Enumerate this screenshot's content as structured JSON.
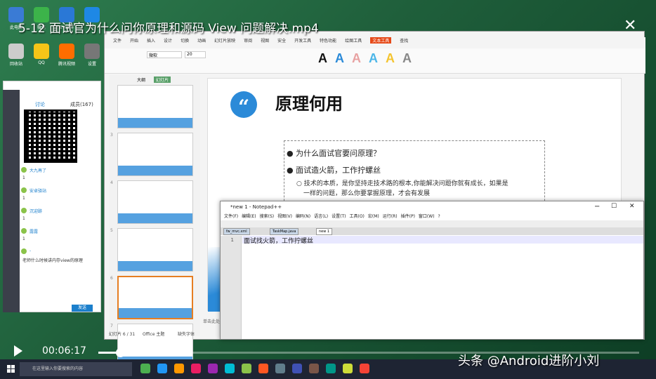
{
  "video": {
    "title": "5-12 面试官为什么问你原理和源码 View 问题解决.mp4",
    "elapsed": "00:06:17",
    "progress_fraction": 0.04
  },
  "watermark": "头条 @Android进阶小刘",
  "desktop_icons": [
    {
      "label": "此电脑",
      "color": "#3a7bd5"
    },
    {
      "label": "微信",
      "color": "#3cb34a"
    },
    {
      "label": "EV录屏",
      "color": "#2a78d6"
    },
    {
      "label": "IE",
      "color": "#1e88e5"
    },
    {
      "label": "回收站",
      "color": "#cccccc"
    },
    {
      "label": "QQ",
      "color": "#f5c518"
    },
    {
      "label": "腾讯视频",
      "color": "#ff6d00"
    },
    {
      "label": "设置",
      "color": "#777777"
    }
  ],
  "chat": {
    "tab_chat": "讨论",
    "tab_members": "成员(167)",
    "items": [
      {
        "name": "大九再了",
        "msg": "1"
      },
      {
        "name": "安卓驿站",
        "msg": "1"
      },
      {
        "name": "沉迎跡",
        "msg": "1"
      },
      {
        "name": "露露",
        "msg": "1"
      },
      {
        "name": "-",
        "msg": "老师什么时候讲内存view的原理"
      }
    ],
    "send_label": "发送"
  },
  "wps": {
    "menu": [
      "文件",
      "开始",
      "插入",
      "设计",
      "切换",
      "动画",
      "幻灯片放映",
      "审阅",
      "视图",
      "安全",
      "开发工具",
      "特色功能",
      "绘图工具",
      "文本工具",
      "查找"
    ],
    "font_name": "微软",
    "font_size": "20",
    "panel_tabs": [
      "大纲",
      "幻灯片"
    ],
    "slide_count_label": "幻灯片 6 / 31",
    "theme_label": "Office 主题",
    "missing_font": "缺失字体",
    "notes": "单击此处添加备注",
    "slide": {
      "title": "原理何用",
      "bullet1": "为什么面试官要问原理？",
      "bullet2": "面试造火箭，工作拧螺丝",
      "sub1": "技术的本质，是你坚持走技术路的根本,你能解决问题你就有成长，如果是",
      "sub2": "一样的问题，那么你要掌握原理，才会有发展"
    },
    "thumb_numbers": [
      "",
      "3",
      "4",
      "5",
      "6",
      "7"
    ]
  },
  "notepad": {
    "title": "*new 1 - Notepad++",
    "menu": [
      "文件(F)",
      "编辑(E)",
      "搜索(S)",
      "视图(V)",
      "编码(N)",
      "语言(L)",
      "设置(T)",
      "工具(O)",
      "宏(M)",
      "运行(R)",
      "插件(P)",
      "窗口(W)",
      "?"
    ],
    "tabs": [
      "fw_mvc.xml",
      "TaskMap.java",
      "new 1"
    ],
    "line_no": "1",
    "line_text": "面试找火箭，工作拧螺丝"
  },
  "taskbar": {
    "search_placeholder": "在这里输入你要搜索的内容",
    "apps": [
      "#4caf50",
      "#2196f3",
      "#ff9800",
      "#e91e63",
      "#9c27b0",
      "#00bcd4",
      "#8bc34a",
      "#ff5722",
      "#607d8b",
      "#3f51b5",
      "#795548",
      "#009688",
      "#cddc39",
      "#f44336"
    ]
  },
  "colors": {
    "accent_blue": "#2b8ad8",
    "wps_tab_active": "#e64a19"
  }
}
